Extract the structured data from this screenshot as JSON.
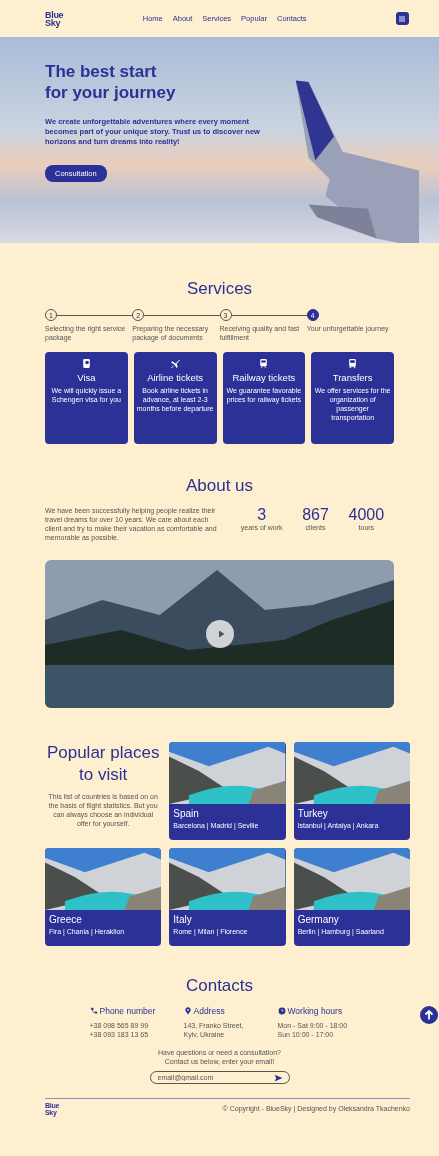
{
  "nav": {
    "logo": [
      "Blue",
      "Sky"
    ],
    "links": [
      "Home",
      "About",
      "Services",
      "Popular",
      "Contacts"
    ]
  },
  "hero": {
    "title": [
      "The best start",
      "for your journey"
    ],
    "text": "We create unforgettable adventures where every moment becomes part of your unique story. Trust us to discover new horizons and turn dreams into reality!",
    "button": "Consultation"
  },
  "services": {
    "title": "Services",
    "steps": [
      {
        "number": "1",
        "label": "Selecting the right service package",
        "selected": false
      },
      {
        "number": "2",
        "label": "Preparing the necessary package of documents",
        "selected": false
      },
      {
        "number": "3",
        "label": "Receiving quality and fast fulfillment",
        "selected": false
      },
      {
        "number": "4",
        "label": "Your unforgettable journey",
        "selected": true
      }
    ],
    "cards": [
      {
        "kind": "visa",
        "title": "Visa",
        "text": "We will quickly issue a Schengen visa for you"
      },
      {
        "kind": "plane",
        "title": "Airline tickets",
        "text": "Book airline tickets in advance, at least 2-3 months before departure"
      },
      {
        "kind": "train",
        "title": "Railway tickets",
        "text": "We guarantee favorable prices for railway tickets"
      },
      {
        "kind": "bus",
        "title": "Transfers",
        "text": "We offer services for the organization of passenger transportation"
      }
    ]
  },
  "about": {
    "title": "About us",
    "text": "We have been successfully helping people realize their travel dreams for over 10 years. We care about each client and try to make their vacation as comfortable and memorable as possible.",
    "stats": [
      {
        "value": "3",
        "label": "years of work"
      },
      {
        "value": "867",
        "label": "clients"
      },
      {
        "value": "4000",
        "label": "tours"
      }
    ]
  },
  "popular": {
    "title": [
      "Popular places",
      "to visit"
    ],
    "text": "This list of countries is based on on the basis of flight statistics. But you can always choose an individual offer for yourself.",
    "places": [
      {
        "name": "Spain",
        "cities": "Barcelona | Madrid | Seville"
      },
      {
        "name": "Turkey",
        "cities": "Istanbul | Antalya | Ankara"
      },
      {
        "name": "Greece",
        "cities": "Fira | Chania | Heraklion"
      },
      {
        "name": "Italy",
        "cities": "Rome | Milan | Florence"
      },
      {
        "name": "Germany",
        "cities": "Berlin | Hamburg | Saarland"
      }
    ]
  },
  "contacts": {
    "title": "Contacts",
    "columns": [
      {
        "kind": "phone",
        "heading": "Phone number",
        "lines": [
          "+38 098 565 89 99",
          "+38 093 183 13 65"
        ]
      },
      {
        "kind": "pin",
        "heading": "Address",
        "lines": [
          "143, Franko Street,",
          "Kyiv, Ukraine"
        ]
      },
      {
        "kind": "clock",
        "heading": "Working hours",
        "lines": [
          "Mon - Sat 9:00 - 18:00",
          "Sun 10:00 - 17:00"
        ]
      }
    ],
    "prompt": [
      "Have questions or need a consultation?",
      "Contact us below, enter your email!"
    ],
    "email_placeholder": "email@gmail.com"
  },
  "footer": {
    "logo": [
      "Blue",
      "Sky"
    ],
    "copyright": "© Copyright - BlueSky | Designed by Oleksandra Tkachenko"
  }
}
